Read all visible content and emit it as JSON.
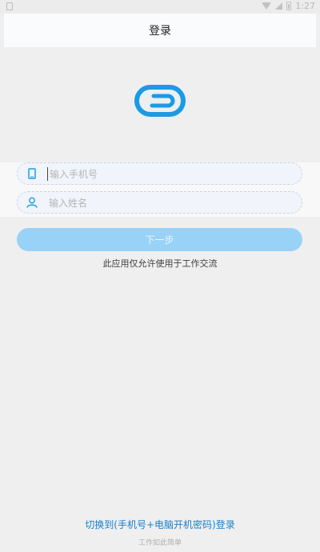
{
  "status_bar": {
    "time": "1:27"
  },
  "header": {
    "title": "登录"
  },
  "logo": {
    "color": "#1a9be6"
  },
  "form": {
    "phone": {
      "placeholder": "输入手机号",
      "icon": "phone-icon"
    },
    "name": {
      "placeholder": "输入姓名",
      "icon": "user-icon"
    }
  },
  "next_button": {
    "label": "下一步",
    "color": "#98d2f7"
  },
  "notice": "此应用仅允许使用于工作交流",
  "switch_link": "切换到(手机号+电脑开机密码)登录",
  "slogan": "工作如此简单"
}
